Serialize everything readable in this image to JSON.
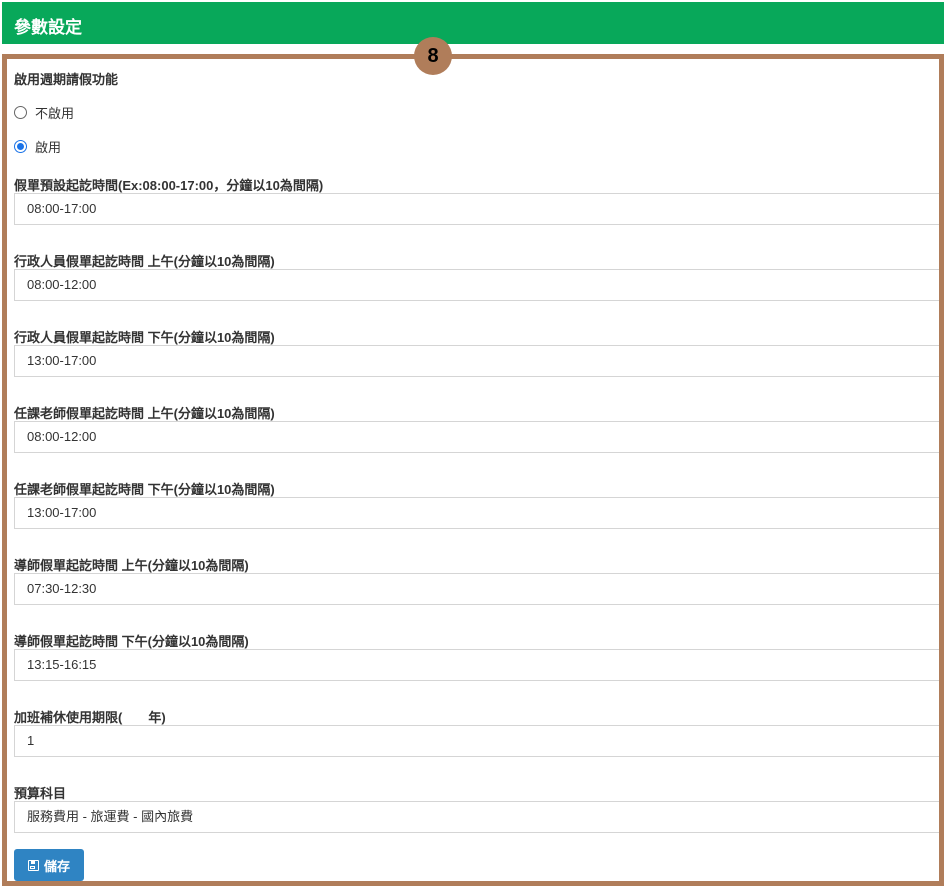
{
  "header": {
    "title": "參數設定"
  },
  "badge": "8",
  "weekly_leave": {
    "label": "啟用週期請假功能",
    "options": [
      {
        "label": "不啟用",
        "checked": false
      },
      {
        "label": "啟用",
        "checked": true
      }
    ]
  },
  "fields": [
    {
      "label": "假單預設起訖時間(Ex:08:00-17:00，分鐘以10為間隔)",
      "value": "08:00-17:00"
    },
    {
      "label": "行政人員假單起訖時間 上午(分鐘以10為間隔)",
      "value": "08:00-12:00"
    },
    {
      "label": "行政人員假單起訖時間 下午(分鐘以10為間隔)",
      "value": "13:00-17:00"
    },
    {
      "label": "任課老師假單起訖時間 上午(分鐘以10為間隔)",
      "value": "08:00-12:00"
    },
    {
      "label": "任課老師假單起訖時間 下午(分鐘以10為間隔)",
      "value": "13:00-17:00"
    },
    {
      "label": "導師假單起訖時間 上午(分鐘以10為間隔)",
      "value": "07:30-12:30"
    },
    {
      "label": "導師假單起訖時間 下午(分鐘以10為間隔)",
      "value": "13:15-16:15"
    },
    {
      "label": "加班補休使用期限(　　年)",
      "value": "1"
    }
  ],
  "budget": {
    "label": "預算科目",
    "value": "服務費用 - 旅運費 - 國內旅費"
  },
  "save_button": {
    "label": "儲存",
    "icon": "floppy-disk-icon"
  },
  "colors": {
    "header_bg": "#08a85a",
    "panel_border": "#b07d5a",
    "button_bg": "#2f84c3",
    "radio_checked": "#1a73e8"
  }
}
